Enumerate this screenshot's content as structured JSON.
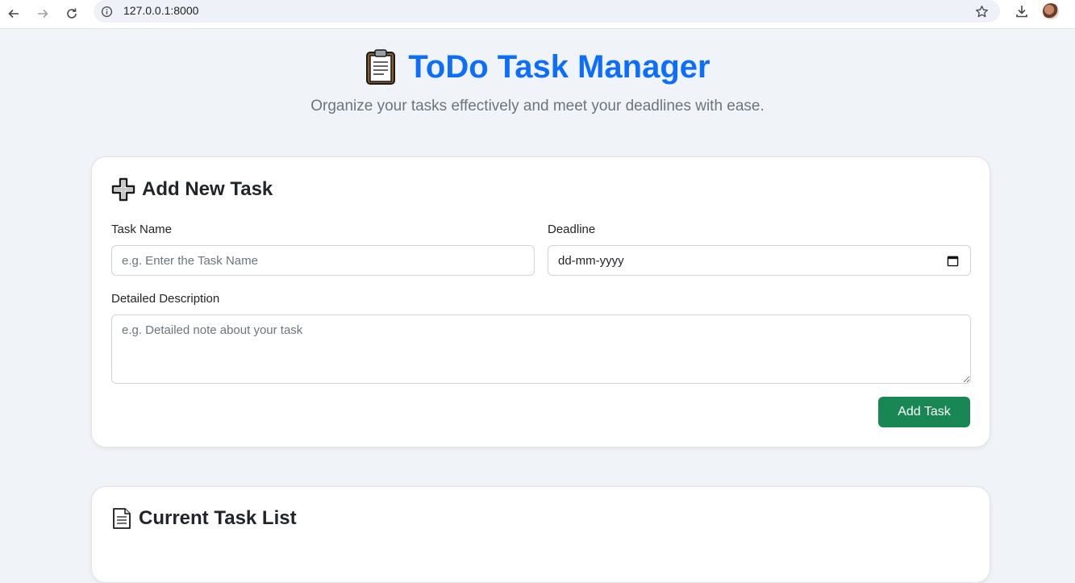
{
  "browser": {
    "url": "127.0.0.1:8000"
  },
  "header": {
    "title": "ToDo Task Manager",
    "subtitle": "Organize your tasks effectively and meet your deadlines with ease."
  },
  "add_task": {
    "title": "Add New Task",
    "task_name_label": "Task Name",
    "task_name_placeholder": "e.g. Enter the Task Name",
    "deadline_label": "Deadline",
    "deadline_value": "dd-mm-yyyy",
    "description_label": "Detailed Description",
    "description_placeholder": "e.g. Detailed note about your task",
    "submit_label": "Add Task"
  },
  "task_list": {
    "title": "Current Task List"
  },
  "colors": {
    "accent": "#0d6efd",
    "success": "#198754",
    "background": "#f0f3f8"
  }
}
